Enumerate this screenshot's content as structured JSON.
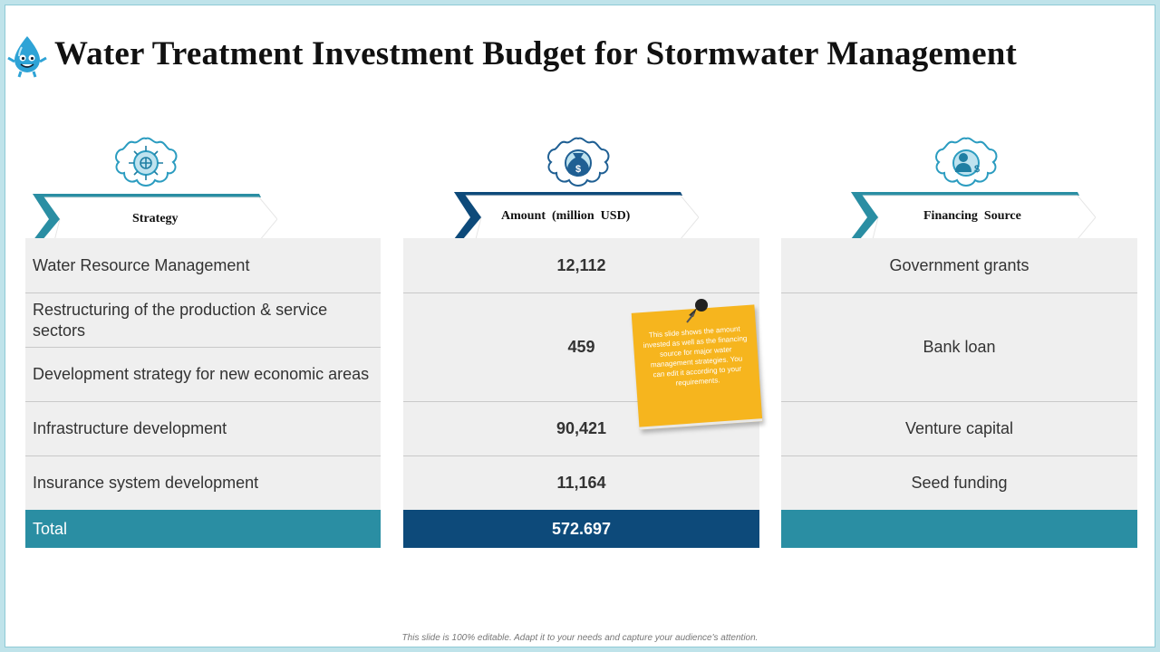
{
  "title": "Water Treatment Investment Budget for Stormwater Management",
  "columns": {
    "strategy": {
      "header": "Strategy",
      "icon": "network-globe-icon"
    },
    "amount": {
      "header": "Amount  (million  USD)",
      "icon": "money-bag-icon"
    },
    "financing": {
      "header": "Financing  Source",
      "icon": "person-dollar-icon"
    }
  },
  "rows": [
    {
      "strategy": "Water Resource Management",
      "amount": "12,112",
      "financing": "Government grants"
    },
    {
      "strategy": "Restructuring of the production & service sectors"
    },
    {
      "strategy": "Development strategy for new economic areas"
    },
    {
      "strategy": "Infrastructure development",
      "amount": "90,421",
      "financing": "Venture capital"
    },
    {
      "strategy": "Insurance system development",
      "amount": "11,164",
      "financing": "Seed funding"
    }
  ],
  "merged": {
    "amount": "459",
    "financing": "Bank loan"
  },
  "total": {
    "label": "Total",
    "amount": "572.697"
  },
  "note": "This slide shows the amount invested as well as the financing source for major water management strategies. You can edit it according to your requirements.",
  "footer": "This slide is 100% editable. Adapt it to your needs and capture your audience's attention.",
  "colors": {
    "teal": "#2a8ea3",
    "navy": "#0d4a7a",
    "note": "#f6b51e",
    "icon": "#2b9cc0"
  }
}
